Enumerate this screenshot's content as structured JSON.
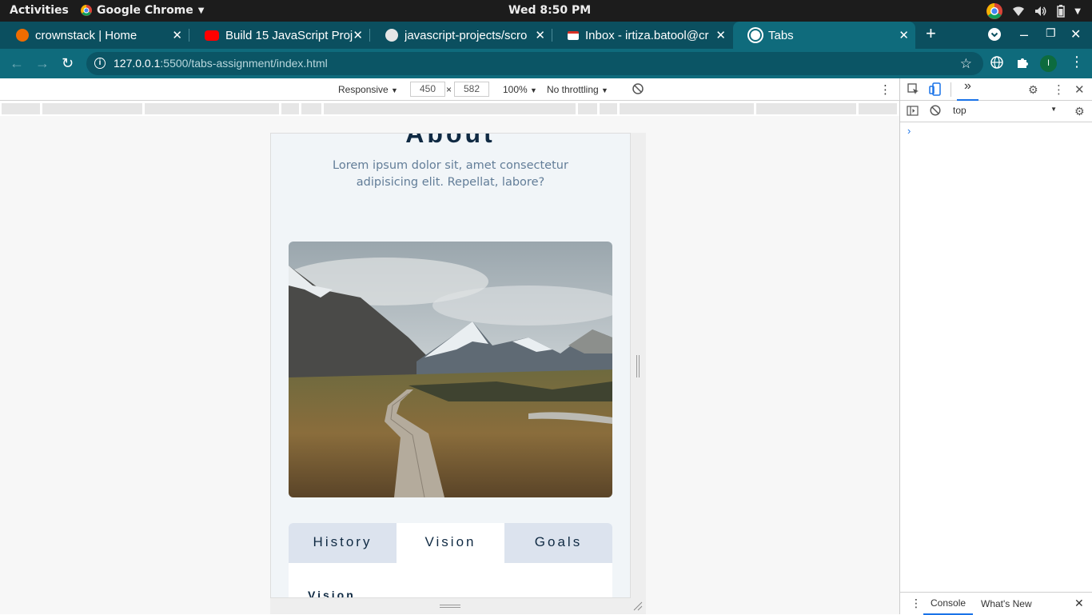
{
  "system_bar": {
    "activities": "Activities",
    "app_name": "Google Chrome",
    "clock": "Wed  8:50 PM",
    "tray_icons": [
      "chrome-icon",
      "wifi-icon",
      "volume-icon",
      "battery-icon",
      "caret-down-icon"
    ]
  },
  "browser": {
    "tabs": [
      {
        "title": "crownstack | Home",
        "favicon": "crownstack-icon",
        "color": "#ef6c00"
      },
      {
        "title": "Build 15 JavaScript Proj",
        "favicon": "youtube-icon",
        "color": "#ff0000"
      },
      {
        "title": "javascript-projects/scro",
        "favicon": "github-icon",
        "color": "#333333"
      },
      {
        "title": "Inbox - irtiza.batool@cr",
        "favicon": "gmail-icon",
        "color": "#d93025"
      },
      {
        "title": "Tabs",
        "favicon": "globe-icon",
        "color": "#ffffff"
      }
    ],
    "new_tab": "+",
    "url_host": "127.0.0.1",
    "url_path": ":5500/tabs-assignment/index.html",
    "profile_initial": "I"
  },
  "device_toolbar": {
    "mode": "Responsive",
    "width": "450",
    "times": "×",
    "height": "582",
    "zoom": "100%",
    "throttling": "No throttling"
  },
  "page": {
    "title": "About",
    "subtitle": "Lorem ipsum dolor sit, amet consectetur adipisicing elit. Repellat, labore?",
    "tabs": [
      {
        "label": "History",
        "active": false
      },
      {
        "label": "Vision",
        "active": true
      },
      {
        "label": "Goals",
        "active": false
      }
    ],
    "panel_heading": "Vision"
  },
  "devtools": {
    "more_tabs": "»",
    "context": "top",
    "drawer_tabs": [
      "Console",
      "What's New"
    ]
  },
  "colors": {
    "accent": "#0f6b7c",
    "tab_strip": "#0b4f5f",
    "page_bg": "#f1f5f8",
    "title": "#102a43",
    "muted": "#627d98"
  }
}
